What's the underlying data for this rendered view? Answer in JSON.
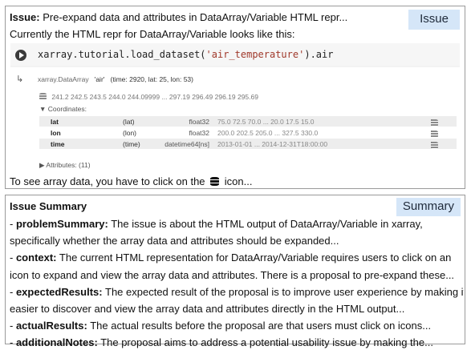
{
  "issue": {
    "tag": "Issue",
    "heading_label": "Issue:",
    "heading_text": "Pre-expand data and attributes in DataArray/Variable HTML repr...",
    "line2": "Currently the HTML repr for DataArray/Variable looks like this:",
    "footer_before": "To see array data, you have to click on the",
    "footer_after": "icon...",
    "code": {
      "prefix": "xarray.tutorial.load_dataset(",
      "string": "'air_temperature'",
      "suffix": ").air"
    },
    "output": {
      "type": "xarray.DataArray",
      "name": "'air'",
      "dims": "(time: 2920, lat: 25, lon: 53)",
      "data_preview": "241.2 242.5 243.5 244.0 244.09999 ... 297.19 296.49 296.19 295.69",
      "coordinates_label": "▼ Coordinates:",
      "coordinates": [
        {
          "name": "lat",
          "dims": "(lat)",
          "dtype": "float32",
          "preview": "75.0 72.5 70.0 ... 20.0 17.5 15.0"
        },
        {
          "name": "lon",
          "dims": "(lon)",
          "dtype": "float32",
          "preview": "200.0 202.5 205.0 ... 327.5 330.0"
        },
        {
          "name": "time",
          "dims": "(time)",
          "dtype": "datetime64[ns]",
          "preview": "2013-01-01 ... 2014-12-31T18:00:00"
        }
      ],
      "attributes_label": "▶ Attributes: (11)"
    }
  },
  "summary": {
    "tag": "Summary",
    "title": "Issue Summary",
    "items": [
      {
        "key": "problemSummary:",
        "line1": "The issue is about the HTML output of DataArray/Variable in xarray,",
        "line2": "specifically whether the array data and attributes should be expanded..."
      },
      {
        "key": "context:",
        "line1": "The current HTML representation for DataArray/Variable requires users to click on an",
        "line2": "icon to expand and view the array data and attributes. There is a proposal to pre-expand these..."
      },
      {
        "key": "expectedResults:",
        "line1": "The expected result of the proposal is to improve user experience by making it",
        "line2": "easier to discover and view the array data and attributes directly in the HTML output..."
      },
      {
        "key": "actualResults:",
        "line1": "The actual results before the proposal are that users must click on icons...",
        "line2": ""
      },
      {
        "key": "additionalNotes:",
        "line1": "The proposal aims to address a potential usability issue by making the...",
        "line2": ""
      }
    ]
  },
  "colors": {
    "tag_bg": "#d5e6f8",
    "border": "#9a9a9a"
  }
}
